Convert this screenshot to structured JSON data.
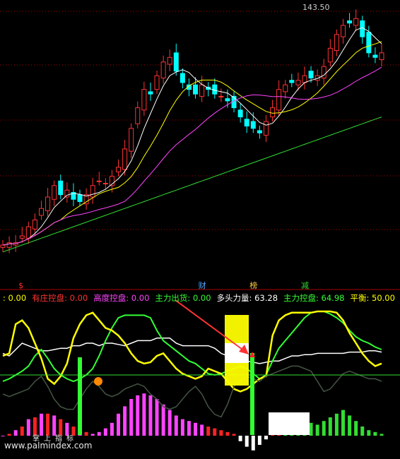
{
  "price_panel": {
    "peak_label": "143.50",
    "signal_badges": [
      {
        "text": "$",
        "color": "#ff3333",
        "x_index": 3
      },
      {
        "text": "财",
        "color": "#4da6ff",
        "x_index": 31
      },
      {
        "text": "榜",
        "color": "#ffcc44",
        "x_index": 39
      },
      {
        "text": "减",
        "color": "#33dd33",
        "x_index": 47
      }
    ]
  },
  "legend": {
    "items": [
      {
        "label": ": 0.00",
        "color": "#ffff00"
      },
      {
        "label": "有庄控盘: 0.00",
        "color": "#ff3333"
      },
      {
        "label": "高度控盘: 0.00",
        "color": "#ff44ff"
      },
      {
        "label": "主力出货: 0.00",
        "color": "#33ff33"
      },
      {
        "label": "多头力量: 63.28",
        "color": "#ffffff"
      },
      {
        "label": "主力控盘: 64.98",
        "color": "#33ff33"
      },
      {
        "label": "平衡: 50.00",
        "color": "#ffff00"
      }
    ]
  },
  "watermark": {
    "url": "www.palmindex.com",
    "cn": "掌上指标"
  },
  "colors": {
    "up": "#ff3333",
    "down": "#00ffff",
    "grid": "#aa0000",
    "ma5": "#ffffff",
    "ma10": "#ffff00",
    "ma20": "#ff44ff",
    "ma60": "#33dd33"
  },
  "chart_data": [
    {
      "type": "candlestick",
      "title": "",
      "x_count": 60,
      "ylim": [
        40,
        148
      ],
      "grid": true,
      "ohlc_close": [
        44,
        45,
        45,
        48,
        52,
        55,
        60,
        65,
        70,
        66,
        68,
        64,
        63,
        66,
        70,
        72,
        71,
        74,
        78,
        86,
        95,
        104,
        112,
        110,
        118,
        124,
        126,
        120,
        115,
        112,
        110,
        114,
        112,
        110,
        109,
        107,
        104,
        100,
        96,
        95,
        93,
        98,
        104,
        112,
        114,
        115,
        116,
        118,
        117,
        118,
        122,
        130,
        136,
        140,
        141,
        143,
        135,
        128,
        126,
        128
      ],
      "ma60": [
        41,
        42,
        43,
        44,
        45,
        46,
        47,
        48,
        49,
        50,
        51,
        52,
        53,
        54,
        55,
        56,
        57,
        58,
        59,
        60,
        61,
        62,
        63,
        64,
        65,
        66,
        67,
        68,
        69,
        70,
        71,
        72,
        73,
        74,
        75,
        76,
        77,
        78,
        79,
        80,
        81,
        82,
        83,
        84,
        85,
        86,
        87,
        88,
        89,
        90,
        91,
        92,
        93,
        94,
        95,
        96,
        97,
        98,
        99,
        100
      ]
    },
    {
      "type": "line",
      "title": "",
      "x_count": 60,
      "ylim": [
        0,
        100
      ],
      "series": [
        {
          "name": "多头力量",
          "color": "#ffffff",
          "values": [
            62,
            60,
            65,
            70,
            68,
            66,
            64,
            64,
            65,
            66,
            66,
            68,
            68,
            70,
            70,
            68,
            70,
            70,
            69,
            68,
            70,
            72,
            72,
            72,
            74,
            74,
            74,
            70,
            68,
            68,
            68,
            68,
            68,
            66,
            62,
            60,
            58,
            57,
            56,
            55,
            54,
            55,
            56,
            56,
            58,
            60,
            60,
            61,
            61,
            62,
            62,
            62,
            62,
            62,
            63,
            63,
            63,
            64,
            64,
            63
          ]
        },
        {
          "name": "主力控盘",
          "color": "#33ff33",
          "values": [
            40,
            42,
            45,
            48,
            52,
            60,
            65,
            58,
            50,
            45,
            42,
            40,
            42,
            45,
            50,
            60,
            72,
            82,
            90,
            92,
            92,
            92,
            92,
            90,
            80,
            72,
            68,
            64,
            60,
            56,
            54,
            50,
            46,
            45,
            46,
            48,
            50,
            52,
            50,
            46,
            42,
            45,
            56,
            66,
            72,
            78,
            84,
            90,
            94,
            95,
            95,
            93,
            90,
            86,
            80,
            75,
            72,
            70,
            67,
            65
          ]
        },
        {
          "name": "平衡",
          "color": "#ffff00",
          "values": [
            60,
            62,
            85,
            88,
            82,
            70,
            58,
            42,
            38,
            44,
            54,
            74,
            85,
            92,
            94,
            88,
            82,
            80,
            76,
            70,
            62,
            56,
            54,
            55,
            60,
            62,
            56,
            50,
            46,
            44,
            42,
            44,
            50,
            48,
            46,
            40,
            34,
            32,
            34,
            38,
            42,
            44,
            76,
            88,
            92,
            94,
            94,
            94,
            94,
            95,
            95,
            95,
            94,
            88,
            78,
            70,
            62,
            56,
            52,
            54
          ]
        },
        {
          "name": "主力出货",
          "color": "#445544",
          "values": [
            30,
            28,
            30,
            32,
            34,
            40,
            44,
            36,
            26,
            20,
            18,
            18,
            26,
            34,
            40,
            36,
            30,
            28,
            30,
            34,
            36,
            38,
            36,
            30,
            26,
            20,
            18,
            20,
            26,
            32,
            36,
            30,
            20,
            14,
            12,
            22,
            36,
            40,
            44,
            42,
            40,
            44,
            46,
            48,
            50,
            52,
            52,
            50,
            48,
            40,
            32,
            34,
            40,
            46,
            48,
            46,
            44,
            42,
            42,
            40
          ]
        }
      ],
      "bars": [
        0,
        2,
        6,
        10,
        18,
        20,
        24,
        24,
        22,
        18,
        14,
        10,
        6,
        4,
        2,
        4,
        8,
        14,
        24,
        32,
        40,
        44,
        46,
        44,
        40,
        34,
        28,
        22,
        18,
        16,
        14,
        12,
        10,
        8,
        6,
        4,
        2,
        -6,
        -12,
        -16,
        -10,
        -4,
        4,
        8,
        10,
        12,
        14,
        16,
        14,
        12,
        16,
        20,
        24,
        28,
        22,
        16,
        10,
        6,
        4,
        2
      ]
    }
  ]
}
